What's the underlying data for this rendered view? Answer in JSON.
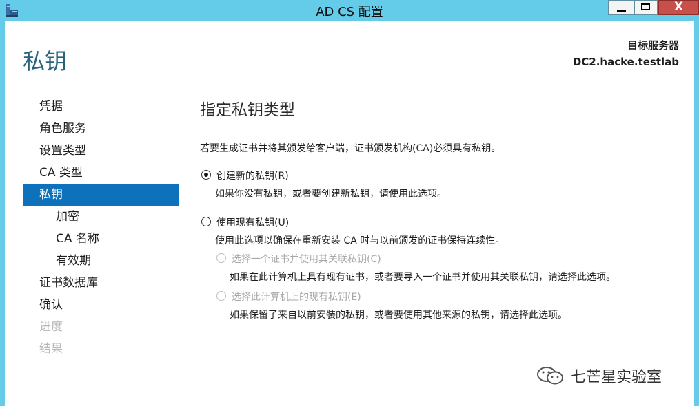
{
  "window": {
    "title": "AD CS 配置",
    "minimize_glyph": "",
    "maximize_glyph": "",
    "close_glyph": "X"
  },
  "header": {
    "page_title": "私钥",
    "target_label": "目标服务器",
    "target_server": "DC2.hacke.testlab"
  },
  "nav": {
    "items": [
      {
        "label": "凭据"
      },
      {
        "label": "角色服务"
      },
      {
        "label": "设置类型"
      },
      {
        "label": "CA 类型"
      },
      {
        "label": "私钥"
      },
      {
        "label": "加密"
      },
      {
        "label": "CA 名称"
      },
      {
        "label": "有效期"
      },
      {
        "label": "证书数据库"
      },
      {
        "label": "确认"
      },
      {
        "label": "进度"
      },
      {
        "label": "结果"
      }
    ]
  },
  "main": {
    "section_title": "指定私钥类型",
    "intro": "若要生成证书并将其颁发给客户端，证书颁发机构(CA)必须具有私钥。",
    "options": {
      "create_new": {
        "label": "创建新的私钥(R)",
        "desc": "如果你没有私钥，或者要创建新私钥，请使用此选项。",
        "selected": true
      },
      "use_existing": {
        "label": "使用现有私钥(U)",
        "desc": "使用此选项以确保在重新安装 CA 时与以前颁发的证书保持连续性。",
        "selected": false
      },
      "select_cert": {
        "label": "选择一个证书并使用其关联私钥(C)",
        "desc": "如果在此计算机上具有现有证书，或者要导入一个证书并使用其关联私钥，请选择此选项。",
        "enabled": false
      },
      "select_existing_key": {
        "label": "选择此计算机上的现有私钥(E)",
        "desc": "如果保留了来自以前安装的私钥，或者要使用其他来源的私钥，请选择此选项。",
        "enabled": false
      }
    }
  },
  "watermark": {
    "text": "七芒星实验室",
    "icon": "wechat-icon"
  },
  "colors": {
    "titlebar": "#64cbe8",
    "accent": "#0d72bb",
    "page_title": "#27627e",
    "close": "#c7504b"
  }
}
